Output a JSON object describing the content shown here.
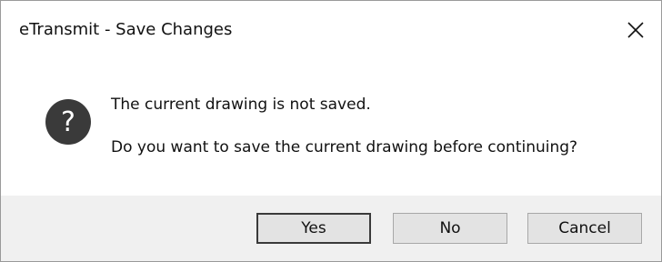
{
  "window": {
    "title": "eTransmit - Save Changes",
    "close_icon": "close-icon"
  },
  "message": {
    "icon": "question-icon",
    "line1": "The current drawing is not saved.",
    "line2": "Do you want to save the current drawing before continuing?"
  },
  "buttons": {
    "yes": "Yes",
    "no": "No",
    "cancel": "Cancel",
    "default": "yes"
  },
  "colors": {
    "icon_fill": "#3a3a3a",
    "footer_bg": "#f0f0f0",
    "button_bg": "#e3e3e3"
  }
}
